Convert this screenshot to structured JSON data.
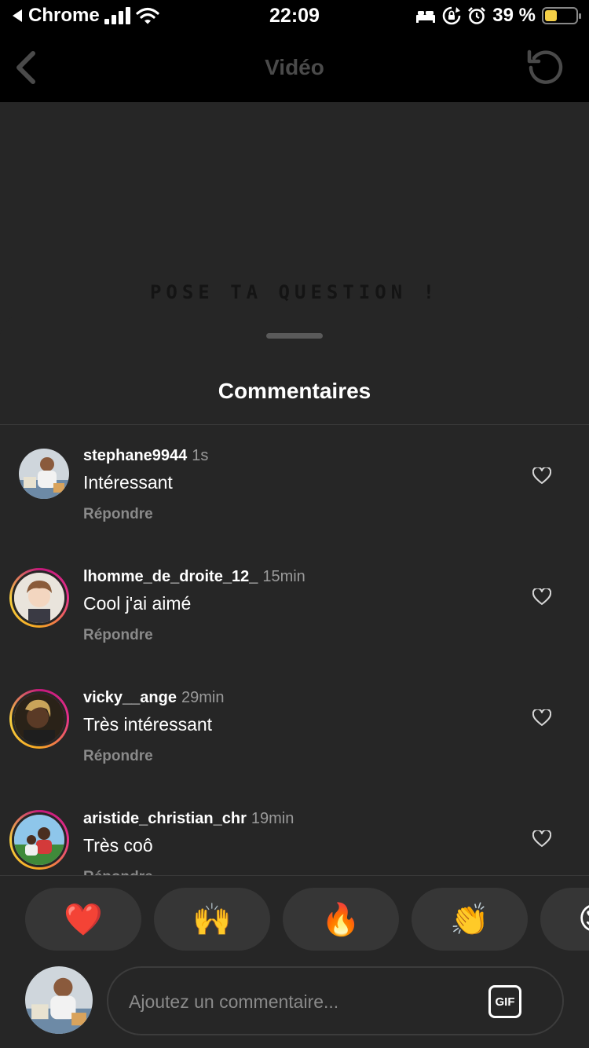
{
  "status_bar": {
    "back_app": "Chrome",
    "time": "22:09",
    "battery_text": "39 %",
    "battery_level": 0.39,
    "battery_color": "#f4cf46"
  },
  "nav": {
    "title": "Vidéo",
    "back_icon": "chevron-left-icon",
    "refresh_icon": "refresh-icon"
  },
  "video": {
    "caption": "POSE TA QUESTION !"
  },
  "sheet": {
    "title": "Commentaires"
  },
  "comments": [
    {
      "username": "stephane9944",
      "time": "1s",
      "text": "Intéressant",
      "reply_label": "Répondre",
      "has_story_ring": false
    },
    {
      "username": "lhomme_de_droite_12_",
      "time": "15min",
      "text": "Cool j'ai aimé",
      "reply_label": "Répondre",
      "has_story_ring": true
    },
    {
      "username": "vicky__ange",
      "time": "29min",
      "text": "Très intéressant",
      "reply_label": "Répondre",
      "has_story_ring": true
    },
    {
      "username": "aristide_christian_chr",
      "time": "19min",
      "text": "Très coô",
      "reply_label": "Répondre",
      "has_story_ring": true
    }
  ],
  "reactions": [
    "❤️",
    "🙌",
    "🔥",
    "👏",
    "😍"
  ],
  "composer": {
    "placeholder": "Ajoutez un commentaire...",
    "gif_label": "GIF"
  },
  "colors": {
    "background": "#000000",
    "sheet": "#262626",
    "muted_text": "#8a8a8a",
    "story_ring": [
      "#c2187a",
      "#f5a623"
    ]
  }
}
